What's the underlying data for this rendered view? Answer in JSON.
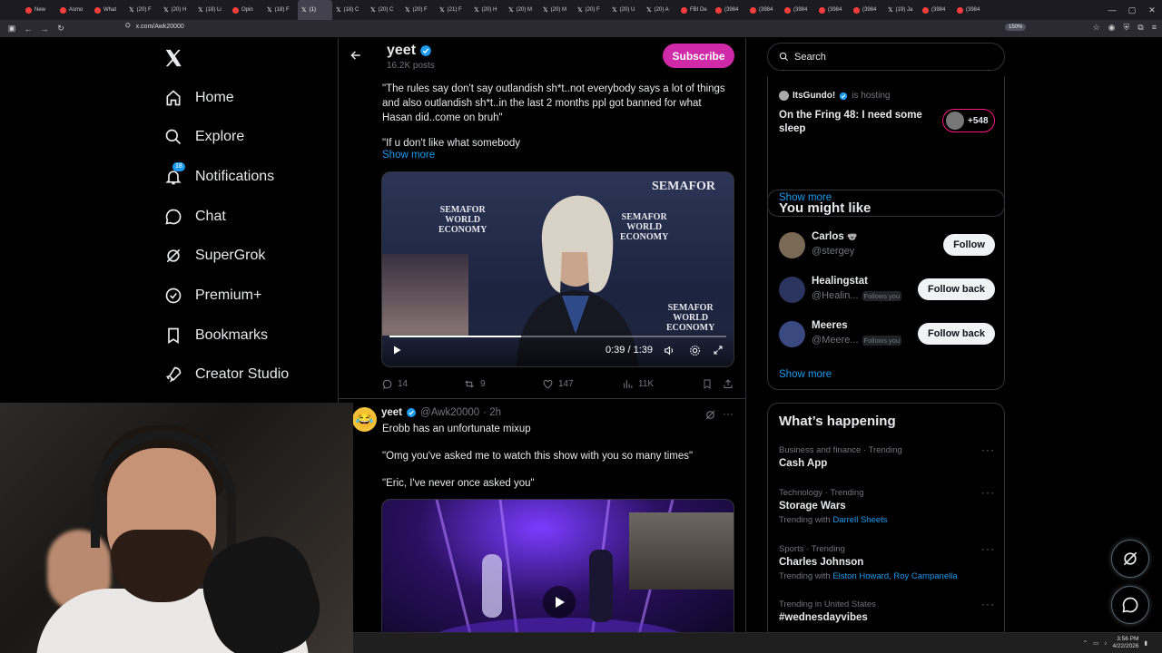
{
  "browser": {
    "tabs": [
      "New",
      "Asmo",
      "What",
      "(20) F",
      "(20) H",
      "(18) Li",
      "Opin",
      "(18) F",
      "(1)",
      "(18) C",
      "(20) C",
      "(20) F",
      "(21) F",
      "(20) H",
      "(20) M",
      "(20) M",
      "(20) F",
      "(20) U",
      "(20) A",
      "FBI De",
      "(3984",
      "(3984",
      "(3984",
      "(3984",
      "(3984",
      "(19) Ja",
      "(3984",
      "(3984"
    ],
    "url": "x.com/Awk20000",
    "zoom": "150%"
  },
  "nav": {
    "items": [
      {
        "label": "Home",
        "icon": "home-icon"
      },
      {
        "label": "Explore",
        "icon": "search-icon"
      },
      {
        "label": "Notifications",
        "icon": "bell-icon"
      },
      {
        "label": "Chat",
        "icon": "chat-icon"
      },
      {
        "label": "SuperGrok",
        "icon": "grok-icon"
      },
      {
        "label": "Premium+",
        "icon": "verified-icon"
      },
      {
        "label": "Bookmarks",
        "icon": "bookmark-icon"
      },
      {
        "label": "Creator Studio",
        "icon": "rocket-icon"
      }
    ],
    "notifications_badge": "18"
  },
  "profile": {
    "name": "yeet",
    "posts": "16.2K posts",
    "subscribe_label": "Subscribe"
  },
  "post1": {
    "text_lines": [
      "\"The rules say don't say outlandish sh*t..not everybody says a lot of things",
      "and also outlandish sh*t..in the last 2 months ppl got banned for what",
      "Hasan did..come on bruh\"",
      "\"If u don't like what somebody"
    ],
    "show_more": "Show more",
    "video": {
      "brand_top": "SEMAFOR",
      "brand_lines": [
        "SEMAFOR",
        "WORLD",
        "ECONOMY"
      ],
      "time": "0:39 / 1:39",
      "progress": 0.39
    },
    "stats": {
      "replies": "14",
      "reposts": "9",
      "likes": "147",
      "views": "11K"
    }
  },
  "post2": {
    "name": "yeet",
    "handle": "@Awk20000",
    "time": "· 2h",
    "text1": "Erobb has an unfortunate mixup",
    "text2": "\"Omg you've asked me to watch this show with you so many times\"",
    "text3": "\"Eric, I've never once asked you\""
  },
  "sidebar": {
    "search_placeholder": "Search",
    "space": {
      "host": "ItsGundo!",
      "status": "is hosting",
      "title": "On the Fring 48: I need some sleep",
      "listeners": "+548",
      "show_more": "Show more"
    },
    "who_to_follow": {
      "title": "You might like",
      "users": [
        {
          "name": "Carlos",
          "handle": "@stergey",
          "follows_you": "",
          "button": "Follow",
          "color": "#7a6a55"
        },
        {
          "name": "Healingstat",
          "handle": "@Healin...",
          "follows_you": "Follows you",
          "button": "Follow back",
          "color": "#2c3560"
        },
        {
          "name": "Meeres",
          "handle": "@Meere...",
          "follows_you": "Follows you",
          "button": "Follow back",
          "color": "#3a4a80"
        }
      ],
      "show_more": "Show more"
    },
    "trends": {
      "title": "What’s happening",
      "items": [
        {
          "context": "Business and finance · Trending",
          "title": "Cash App",
          "with_label": "",
          "with": ""
        },
        {
          "context": "Technology · Trending",
          "title": "Storage Wars",
          "with_label": "Trending with",
          "with": "Darrell Sheets"
        },
        {
          "context": "Sports · Trending",
          "title": "Charles Johnson",
          "with_label": "Trending with",
          "with": "Elston Howard, Roy Campanella"
        },
        {
          "context": "Trending in United States",
          "title": "#wednesdayvibes",
          "with_label": "",
          "with": ""
        }
      ]
    }
  },
  "taskbar": {
    "time": "3:56 PM",
    "date": "4/22/2026"
  }
}
